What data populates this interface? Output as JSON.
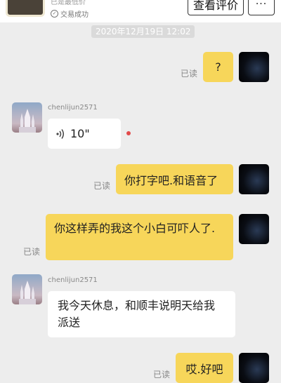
{
  "header": {
    "product_subtitle": "已是最低价",
    "status_text": "交易成功",
    "review_button": "查看评价",
    "more_button": "···"
  },
  "timestamp": "2020年12月19日 12:02",
  "read_label": "已读",
  "messages": [
    {
      "side": "me",
      "text": "?"
    },
    {
      "side": "other",
      "username": "chenlijun2571",
      "voice_duration": "10\""
    },
    {
      "side": "me",
      "text": "你打字吧.和语音了"
    },
    {
      "side": "me",
      "text": "你这样弄的我这个小白可吓人了."
    },
    {
      "side": "other",
      "username": "chenlijun2571",
      "text": "我今天休息，和顺丰说明天给我派送"
    },
    {
      "side": "me",
      "text": "哎.好吧"
    }
  ]
}
